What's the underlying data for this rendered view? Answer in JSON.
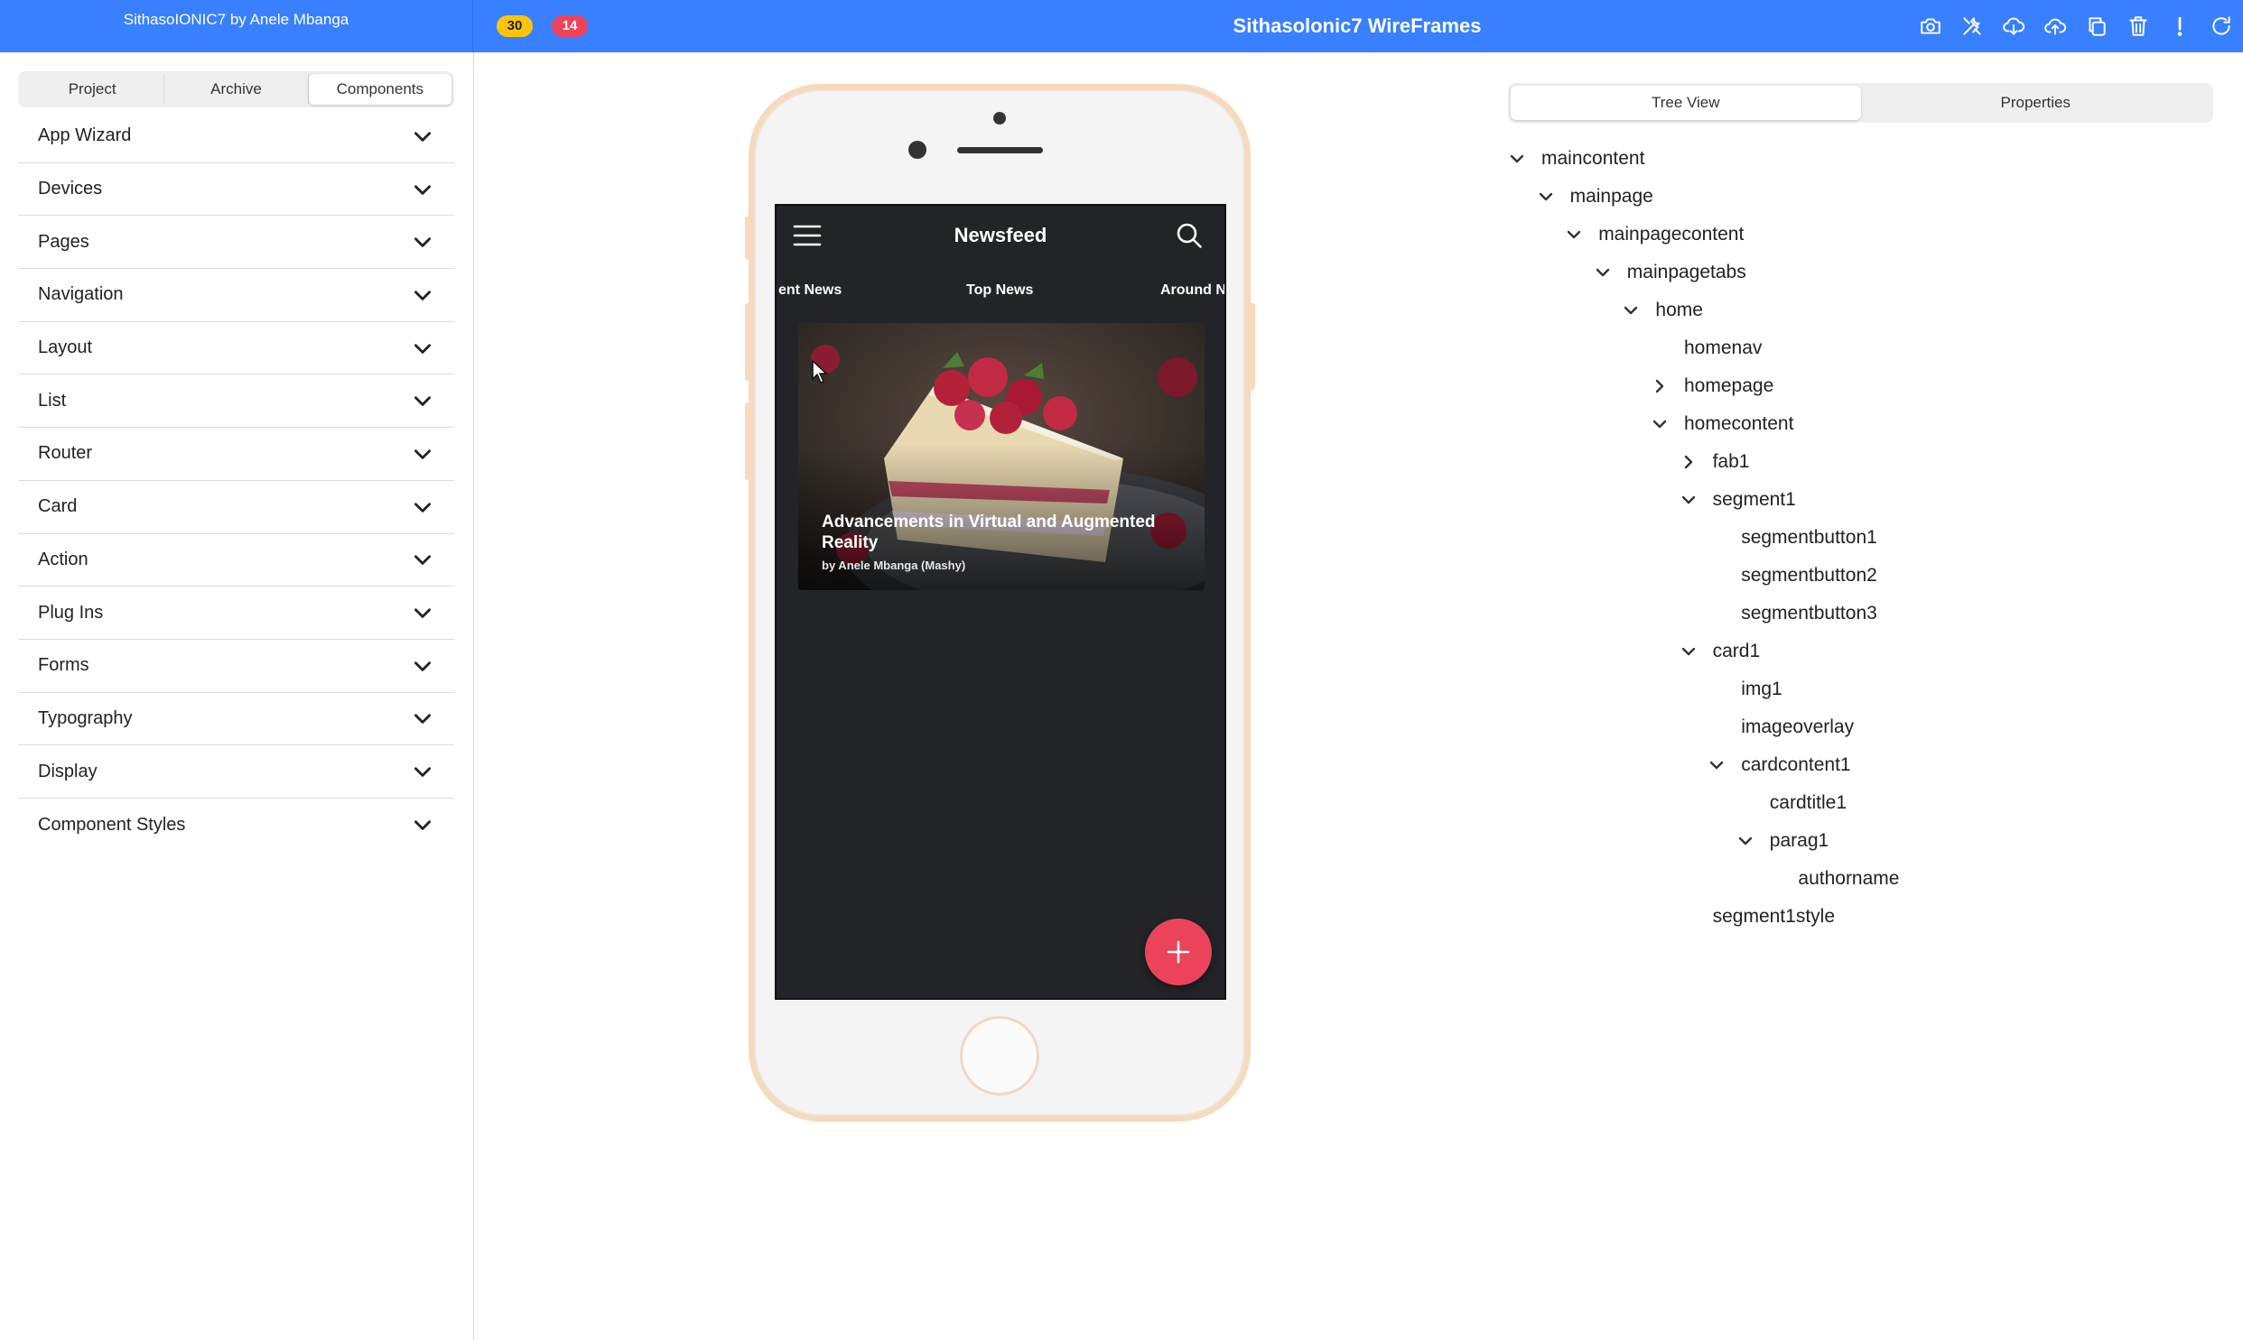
{
  "topbar": {
    "left_title": "SithasoIONIC7 by Anele Mbanga",
    "badge_yellow": "30",
    "badge_red": "14",
    "app_title": "Sithasolonic7 WireFrames",
    "tools": [
      "camera-icon",
      "tools-icon",
      "cloud-download-icon",
      "cloud-upload-icon",
      "copy-icon",
      "trash-icon",
      "alert-icon",
      "refresh-icon"
    ]
  },
  "left_panel": {
    "tabs": [
      "Project",
      "Archive",
      "Components"
    ],
    "active_tab": "Components",
    "sections": [
      "App Wizard",
      "Devices",
      "Pages",
      "Navigation",
      "Layout",
      "List",
      "Router",
      "Card",
      "Action",
      "Plug Ins",
      "Forms",
      "Typography",
      "Display",
      "Component Styles"
    ]
  },
  "phone": {
    "toolbar_title": "Newsfeed",
    "tabs": [
      "ent News",
      "Top News",
      "Around N"
    ],
    "card": {
      "title": "Advancements in Virtual and Augmented Reality",
      "author": "by Anele Mbanga (Mashy)"
    },
    "fab_icon": "add-icon"
  },
  "right_panel": {
    "tabs": [
      "Tree View",
      "Properties"
    ],
    "active_tab": "Tree View",
    "tree": [
      {
        "label": "maincontent",
        "level": 0,
        "state": "expanded"
      },
      {
        "label": "mainpage",
        "level": 1,
        "state": "expanded"
      },
      {
        "label": "mainpagecontent",
        "level": 2,
        "state": "expanded"
      },
      {
        "label": "mainpagetabs",
        "level": 3,
        "state": "expanded"
      },
      {
        "label": "home",
        "level": 4,
        "state": "expanded"
      },
      {
        "label": "homenav",
        "level": 5,
        "state": "leaf"
      },
      {
        "label": "homepage",
        "level": 5,
        "state": "collapsed"
      },
      {
        "label": "homecontent",
        "level": 5,
        "state": "expanded"
      },
      {
        "label": "fab1",
        "level": 6,
        "state": "collapsed"
      },
      {
        "label": "segment1",
        "level": 6,
        "state": "expanded"
      },
      {
        "label": "segmentbutton1",
        "level": 7,
        "state": "leaf"
      },
      {
        "label": "segmentbutton2",
        "level": 7,
        "state": "leaf"
      },
      {
        "label": "segmentbutton3",
        "level": 7,
        "state": "leaf"
      },
      {
        "label": "card1",
        "level": 6,
        "state": "expanded"
      },
      {
        "label": "img1",
        "level": 7,
        "state": "leaf"
      },
      {
        "label": "imageoverlay",
        "level": 7,
        "state": "leaf"
      },
      {
        "label": "cardcontent1",
        "level": 7,
        "state": "expanded"
      },
      {
        "label": "cardtitle1",
        "level": 8,
        "state": "leaf"
      },
      {
        "label": "parag1",
        "level": 8,
        "state": "expanded"
      },
      {
        "label": "authorname",
        "level": 9,
        "state": "leaf"
      },
      {
        "label": "segment1style",
        "level": 6,
        "state": "leaf"
      }
    ]
  },
  "colors": {
    "primary": "#3880ff",
    "badge_yellow": "#ffc409",
    "badge_red": "#eb445a",
    "phone_screen": "#222428",
    "phone_frame": "#f7d9bd"
  }
}
